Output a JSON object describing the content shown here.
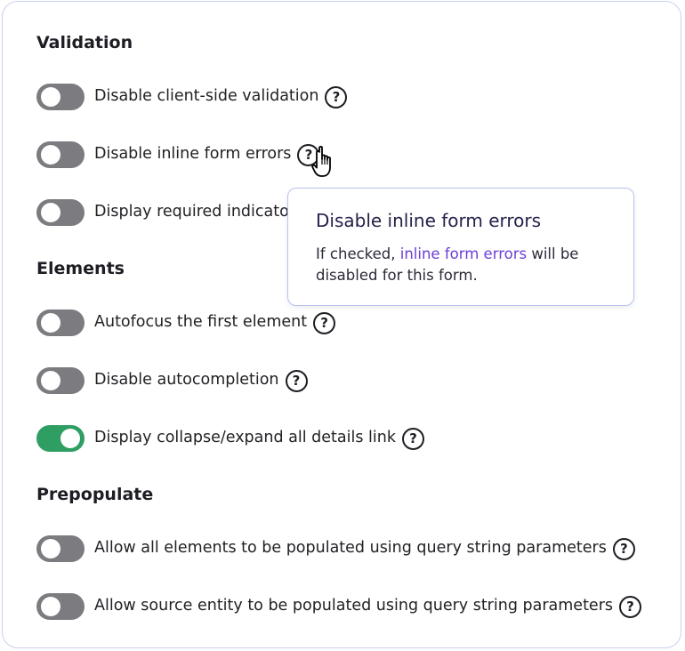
{
  "sections": {
    "validation": {
      "title": "Validation",
      "items": [
        {
          "label": "Disable client-side validation",
          "enabled": false
        },
        {
          "label": "Disable inline form errors",
          "enabled": false
        },
        {
          "label": "Display required indicator",
          "visible_label": "Display required indicato",
          "enabled": false
        }
      ]
    },
    "elements": {
      "title": "Elements",
      "items": [
        {
          "label": "Autofocus the first element",
          "enabled": false
        },
        {
          "label": "Disable autocompletion",
          "enabled": false
        },
        {
          "label": "Display collapse/expand all details link",
          "enabled": true
        }
      ]
    },
    "prepopulate": {
      "title": "Prepopulate",
      "items": [
        {
          "label": "Allow all elements to be populated using query string parameters",
          "enabled": false
        },
        {
          "label": "Allow source entity to be populated using query string parameters",
          "enabled": false
        }
      ]
    }
  },
  "help_glyph": "?",
  "tooltip": {
    "title": "Disable inline form errors",
    "body_prefix": "If checked, ",
    "link_text": "inline form errors",
    "body_suffix": " will be disabled for this form."
  },
  "colors": {
    "toggle_off": "#7b7b80",
    "toggle_on": "#2f9e62",
    "link": "#6a3fd6",
    "card_border": "#c9d0ee"
  },
  "icons": {
    "help": "question-circle-icon",
    "cursor": "hand-pointer-cursor-icon"
  }
}
